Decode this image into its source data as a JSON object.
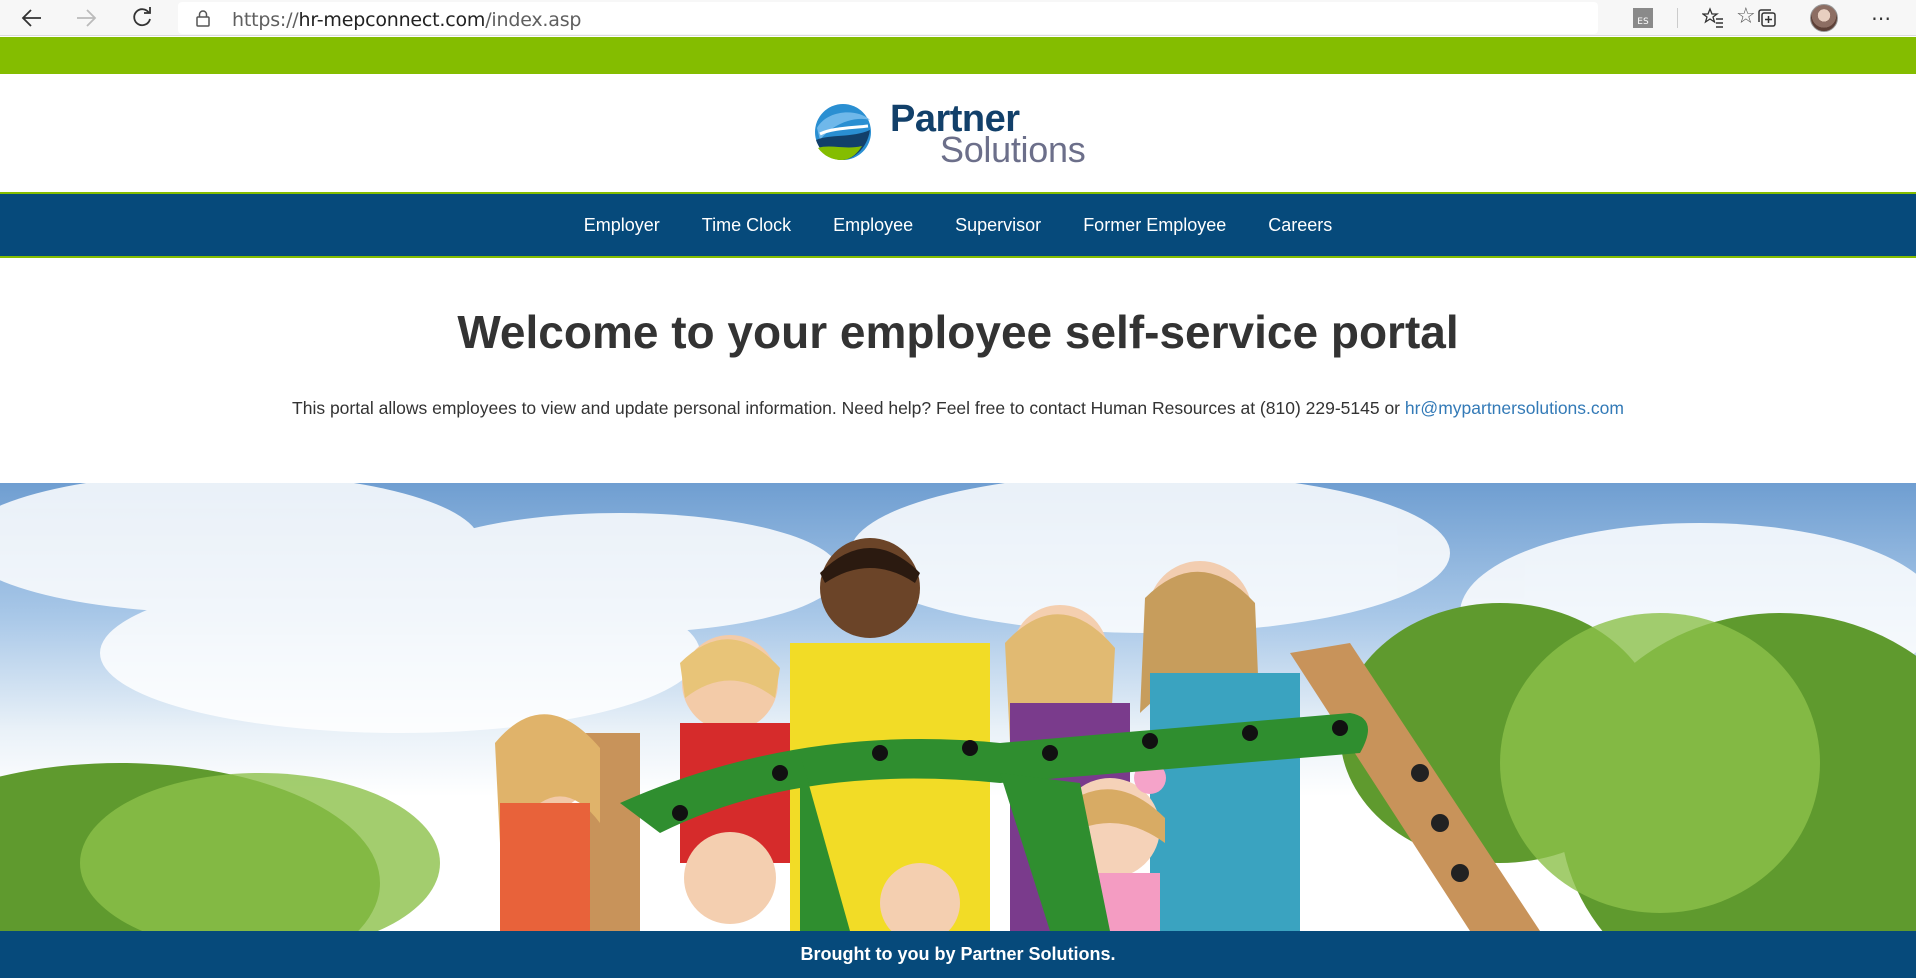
{
  "browser": {
    "url_scheme": "https://",
    "url_host": "hr-mepconnect.com",
    "url_path": "/index.asp",
    "extension_badge": "ES"
  },
  "logo": {
    "word1": "Partner",
    "word2": "Solutions"
  },
  "nav": {
    "items": [
      {
        "label": "Employer"
      },
      {
        "label": "Time Clock"
      },
      {
        "label": "Employee"
      },
      {
        "label": "Supervisor"
      },
      {
        "label": "Former Employee"
      },
      {
        "label": "Careers"
      }
    ]
  },
  "main": {
    "title": "Welcome to your employee self-service portal",
    "intro_text": "This portal allows employees to view and update personal information. Need help? Feel free to contact Human Resources at (810) 229-5145 or ",
    "email_link": "hr@mypartnersolutions.com"
  },
  "footer": {
    "text": "Brought to you by Partner Solutions."
  },
  "colors": {
    "brand_green": "#84bd00",
    "brand_navy": "#064a7b",
    "link_blue": "#337ab7"
  },
  "icons": {
    "back": "back-arrow-icon",
    "forward": "forward-arrow-icon",
    "refresh": "refresh-icon",
    "lock": "lock-icon",
    "favorite": "star-icon",
    "favorites_list": "favorites-icon",
    "collections": "collections-icon",
    "more": "more-icon"
  }
}
